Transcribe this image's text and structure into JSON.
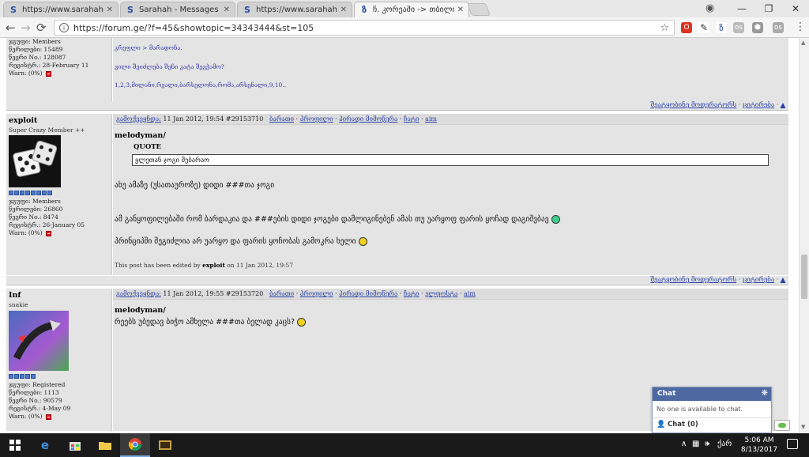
{
  "browser": {
    "tabs": [
      {
        "title": "https://www.sarahah.com",
        "favicon": "S",
        "active": false
      },
      {
        "title": "Sarahah - Messages",
        "favicon": "S",
        "active": false
      },
      {
        "title": "https://www.sarahah.com",
        "favicon": "S",
        "active": false
      },
      {
        "title": "ჩ. კორეაში -> თბილისი",
        "favicon": "ზ",
        "active": true
      }
    ],
    "tab_close": "✕",
    "url": "https://forum.ge/?f=45&showtopic=34343444&st=105",
    "window_controls": {
      "minimize": "—",
      "restore": "❐",
      "close": "✕"
    }
  },
  "posts": {
    "top_partial": {
      "stats": {
        "group": "ჯგუფი: Members",
        "posts": "წერილები: 15489",
        "member_no": "წევრი No.: 128087",
        "joined": "რეგისტრ.: 28-February 11",
        "warn": "Warn: (0%)"
      },
      "sig_lines": [
        "კრეფლი > მარადონა.",
        "ვილი შეიძლება შენი კატა შევჭამო?",
        "1,2,3,მილანი,რეალი,ბარსელონა,რომა,არსენალი,9,10.."
      ]
    },
    "post1": {
      "username": "exploit",
      "usertitle": "Super Crazy Member ++",
      "stats": {
        "group": "ჯგუფი: Members",
        "posts": "წერილები: 26860",
        "member_no": "წევრი No.: 8474",
        "joined": "რეგისტრ.: 26-January 05",
        "warn": "Warn: (0%)"
      },
      "header_prefix": "გამოქვეყნდა:",
      "datetime": "11 Jan 2012, 19:54",
      "post_id": "#29153710",
      "links": [
        "ბარათი",
        "პროფილი",
        "პირადი მიმოწერა",
        "ჩატი",
        "aim"
      ],
      "reply_to": "melodyman/",
      "quote_label": "QUOTE",
      "quote_text": "ყლეთან ჯოგი მებარაო",
      "lines": [
        "ახუ ამაზე (უსათაუროზე) დიდი ###თა ჯოგი",
        "ამ განყოფილებაში რომ ბარდაკია და ###ების დიდი ჯოგები დამლიგინებენ ამას თუ უარყოფ ფარის ყოჩად დაგიშვბავ",
        "პრინციპში შეგიძლია არ უარყო და ფარის ყოჩობას გამოკრა ხელი"
      ],
      "edited_prefix": "This post has been edited by",
      "edited_by": "exploit",
      "edited_suffix": "on 11 Jan 2012, 19:57"
    },
    "post2": {
      "username": "Inf",
      "usertitle": "snakie",
      "stats": {
        "group": "ჯგუფი: Registered",
        "posts": "წერილები: 1113",
        "member_no": "წევრი No.: 90579",
        "joined": "რეგისტრ.: 4-May 09",
        "warn": "Warn: (0%)"
      },
      "header_prefix": "გამოქვეყნდა:",
      "datetime": "11 Jan 2012, 19:55",
      "post_id": "#29153720",
      "links": [
        "ბარათი",
        "პროფილი",
        "პირადი მიმოწერა",
        "ჩატი",
        "ელფოსტა",
        "aim"
      ],
      "reply_to": "melodyman/",
      "lines": [
        "რეებს უბედავ ბიჭო ამხელა ###თა ბელად კაცს?"
      ]
    },
    "footer": {
      "report": "შეატყობინე მოდერატორს",
      "quote": "ციტირება"
    }
  },
  "chat": {
    "header": "Chat",
    "message": "No one is available to chat.",
    "footer": "Chat (0)"
  },
  "taskbar": {
    "time": "5:06 AM",
    "date": "8/13/2017",
    "lang": "ქარ"
  },
  "colors": {
    "accent": "#4e69a2",
    "link": "#2a3fa8",
    "post_bg": "#e4e4e4"
  }
}
